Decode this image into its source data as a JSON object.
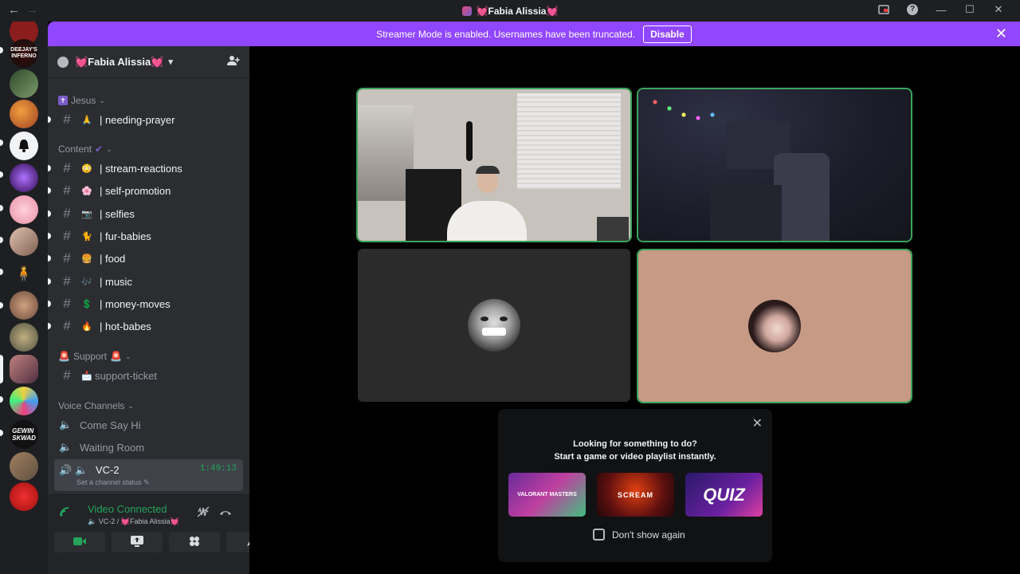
{
  "window": {
    "title": "💓Fabia Alissia💓",
    "back_icon": "arrow-left",
    "forward_icon": "arrow-right"
  },
  "banner": {
    "message": "Streamer Mode is enabled. Usernames have been truncated.",
    "disable_label": "Disable",
    "close_glyph": "✕"
  },
  "server": {
    "name": "💓Fabia Alissia💓"
  },
  "categories": {
    "jesus": "Jesus",
    "content": "Content",
    "support": "Support",
    "voice": "Voice Channels"
  },
  "channels": [
    {
      "emoji": "🙏",
      "name": "| needing-prayer"
    },
    {
      "emoji": "😳",
      "name": "| stream-reactions"
    },
    {
      "emoji": "🌸",
      "name": "| self-promotion"
    },
    {
      "emoji": "📷",
      "name": "| selfies"
    },
    {
      "emoji": "🐈",
      "name": "| fur-babies"
    },
    {
      "emoji": "🍔",
      "name": "| food"
    },
    {
      "emoji": "🎶",
      "name": "| music"
    },
    {
      "emoji": "💲",
      "name": "| money-moves"
    },
    {
      "emoji": "🔥",
      "name": "| hot-babes"
    },
    {
      "emoji": "📩",
      "name": "support-ticket"
    }
  ],
  "voice_channels": [
    {
      "name": "Come Say Hi"
    },
    {
      "name": "Waiting Room"
    },
    {
      "name": "VC-2",
      "time": "1:49:13",
      "status": "Set a channel status"
    }
  ],
  "voice_panel": {
    "title": "Video Connected",
    "subtitle": "VC-2 / 💓Fabia Alissia💓"
  },
  "activity": {
    "line1": "Looking for something to do?",
    "line2": "Start a game or video playlist instantly.",
    "cards": [
      {
        "label": "VALORANT MASTERS"
      },
      {
        "label": "SCREAM"
      },
      {
        "label": "QUIZ"
      }
    ],
    "dont_show": "Don't show again"
  },
  "colors": {
    "accent": "#9147ff",
    "speaking": "#3ba55c",
    "connected": "#23a55a"
  }
}
